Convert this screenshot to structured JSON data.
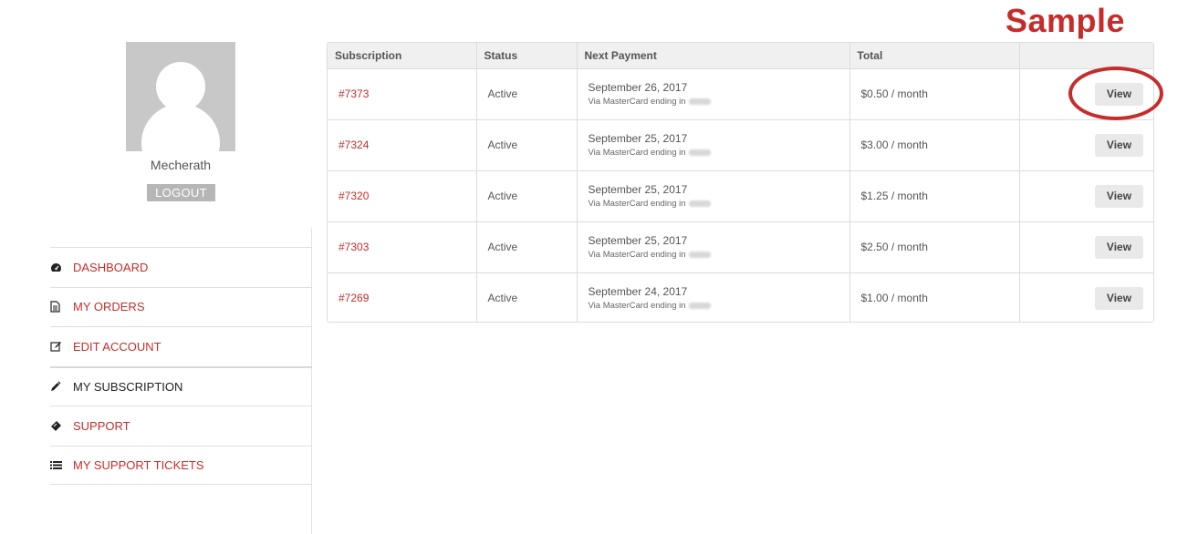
{
  "watermark": "Sample",
  "user": {
    "name": "Mecherath",
    "logout_label": "LOGOUT"
  },
  "nav": [
    {
      "label": "DASHBOARD",
      "icon": "dashboard-icon",
      "active": false
    },
    {
      "label": "MY ORDERS",
      "icon": "document-icon",
      "active": false
    },
    {
      "label": "EDIT ACCOUNT",
      "icon": "edit-icon",
      "active": false
    },
    {
      "label": "MY SUBSCRIPTION",
      "icon": "pencil-icon",
      "active": true
    },
    {
      "label": "SUPPORT",
      "icon": "ticket-icon",
      "active": false
    },
    {
      "label": "MY SUPPORT TICKETS",
      "icon": "list-icon",
      "active": false
    }
  ],
  "table": {
    "headers": [
      "Subscription",
      "Status",
      "Next Payment",
      "Total",
      ""
    ],
    "rows": [
      {
        "id": "#7373",
        "status": "Active",
        "date": "September 26, 2017",
        "via": "Via MasterCard ending in",
        "total": "$0.50 / month",
        "action": "View"
      },
      {
        "id": "#7324",
        "status": "Active",
        "date": "September 25, 2017",
        "via": "Via MasterCard ending in",
        "total": "$3.00 / month",
        "action": "View"
      },
      {
        "id": "#7320",
        "status": "Active",
        "date": "September 25, 2017",
        "via": "Via MasterCard ending in",
        "total": "$1.25 / month",
        "action": "View"
      },
      {
        "id": "#7303",
        "status": "Active",
        "date": "September 25, 2017",
        "via": "Via MasterCard ending in",
        "total": "$2.50 / month",
        "action": "View"
      },
      {
        "id": "#7269",
        "status": "Active",
        "date": "September 24, 2017",
        "via": "Via MasterCard ending in",
        "total": "$1.00 / month",
        "action": "View"
      }
    ]
  },
  "colors": {
    "accent": "#c62d2a",
    "header_bg": "#f0f0f0",
    "button_bg": "#e9e9e9",
    "avatar_bg": "#c8c8c8"
  }
}
